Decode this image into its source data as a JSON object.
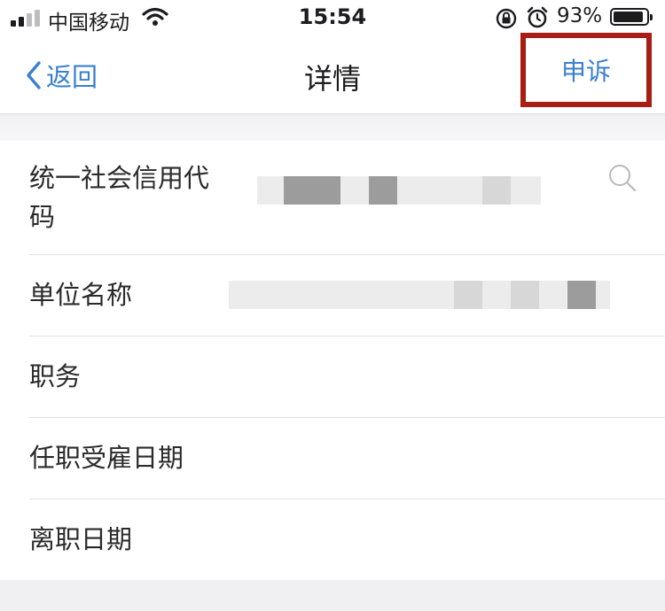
{
  "status_bar": {
    "carrier": "中国移动",
    "time": "15:54",
    "battery_percent": "93%",
    "battery_level": 0.93,
    "icons": [
      "signal-icon",
      "wifi-icon",
      "orientation-lock-icon",
      "alarm-icon",
      "battery-icon"
    ]
  },
  "nav": {
    "back_label": "返回",
    "title": "详情",
    "appeal_label": "申诉",
    "highlight_color": "#a81d14",
    "link_color": "#3a7fcf"
  },
  "rows": [
    {
      "label": "统一社会信用代码",
      "value_redacted": true,
      "trailing_icon": "search-icon"
    },
    {
      "label": "单位名称",
      "value_redacted": true
    },
    {
      "label": "职务"
    },
    {
      "label": "任职受雇日期"
    },
    {
      "label": "离职日期"
    }
  ]
}
